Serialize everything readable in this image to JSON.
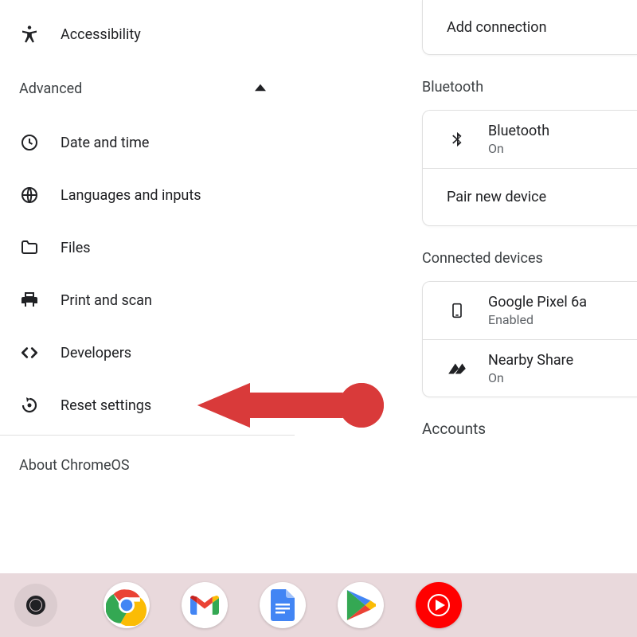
{
  "sidebar": {
    "accessibility": "Accessibility",
    "advanced": "Advanced",
    "date_time": "Date and time",
    "languages": "Languages and inputs",
    "files": "Files",
    "print_scan": "Print and scan",
    "developers": "Developers",
    "reset": "Reset settings",
    "about": "About ChromeOS"
  },
  "main": {
    "add_connection": "Add connection",
    "bluetooth_header": "Bluetooth",
    "bluetooth_title": "Bluetooth",
    "bluetooth_status": "On",
    "pair_new": "Pair new device",
    "connected_header": "Connected devices",
    "phone_name": "Google Pixel 6a",
    "phone_status": "Enabled",
    "nearby_title": "Nearby Share",
    "nearby_status": "On",
    "accounts_header": "Accounts"
  },
  "shelf": {
    "apps": [
      "chrome",
      "gmail",
      "docs",
      "play",
      "ytmusic"
    ]
  }
}
